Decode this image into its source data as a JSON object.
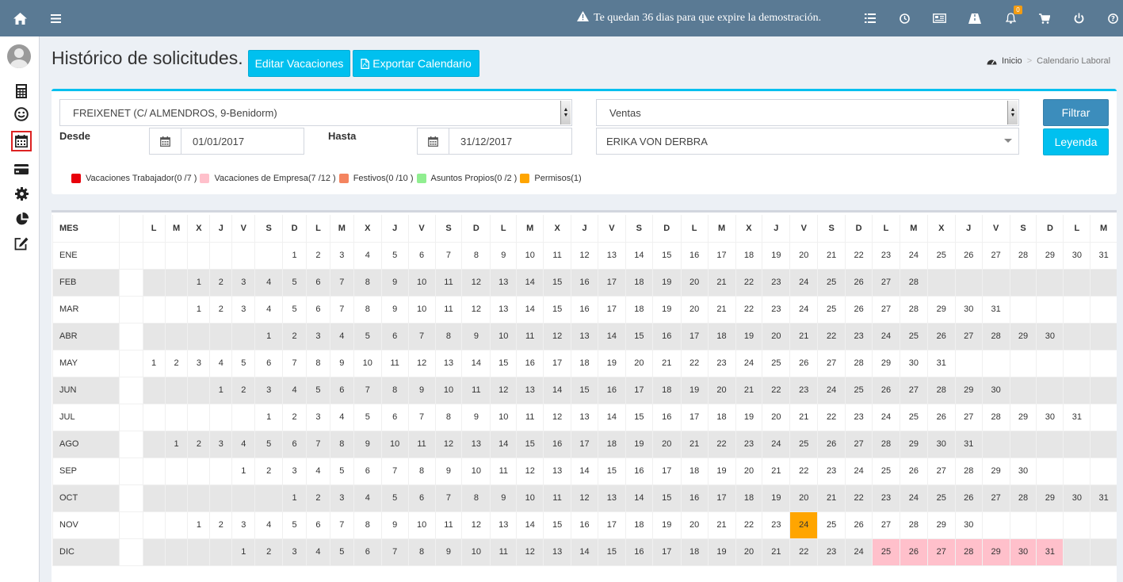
{
  "topbar": {
    "demo_message": "Te quedan 36 dias para que expire la demostración.",
    "notifications_count": "0",
    "icons": [
      "home-icon",
      "menu-icon",
      "warning-icon",
      "list-icon",
      "clock-icon",
      "newspaper-icon",
      "road-icon",
      "bell-icon",
      "cart-icon",
      "power-icon",
      "help-icon"
    ]
  },
  "sidebar": {
    "items": [
      "calculator-icon",
      "smile-icon",
      "calendar-icon",
      "credit-card-icon",
      "gear-icon",
      "pie-chart-icon",
      "edit-icon"
    ],
    "active": "calendar-icon"
  },
  "header": {
    "title": "Histórico de solicitudes.",
    "edit_button": "Editar Vacaciones",
    "export_button": "Exportar Calendario",
    "breadcrumb_home": "Inicio",
    "breadcrumb_current": "Calendario Laboral"
  },
  "filters": {
    "center": "FREIXENET (C/ ALMENDROS, 9-Benidorm)",
    "department": "Ventas",
    "employee": "ERIKA VON DERBRA",
    "from_label": "Desde",
    "from_value": "01/01/2017",
    "to_label": "Hasta",
    "to_value": "31/12/2017",
    "filter_button": "Filtrar",
    "legend_button": "Leyenda"
  },
  "legend": [
    {
      "label": "Vacaciones Trabajador(0 /7 )",
      "color": "#e8000b"
    },
    {
      "label": "Vacaciones de Empresa(7 /12 )",
      "color": "#ffc0cb"
    },
    {
      "label": "Festivos(0 /10 )",
      "color": "#f4845f"
    },
    {
      "label": "Asuntos Propios(0 /2 )",
      "color": "#90ee90"
    },
    {
      "label": "Permisos(1)",
      "color": "#ffa500"
    }
  ],
  "calendar": {
    "month_header": "MES",
    "day_headers": [
      "L",
      "M",
      "X",
      "J",
      "V",
      "S",
      "D",
      "L",
      "M",
      "X",
      "J",
      "V",
      "S",
      "D",
      "L",
      "M",
      "X",
      "J",
      "V",
      "S",
      "D",
      "L",
      "M",
      "X",
      "J",
      "V",
      "S",
      "D",
      "L",
      "M",
      "X",
      "J",
      "V",
      "S",
      "D",
      "L",
      "M"
    ],
    "months": [
      {
        "name": "ENE",
        "offset": 6,
        "days": 31
      },
      {
        "name": "FEB",
        "offset": 2,
        "days": 28
      },
      {
        "name": "MAR",
        "offset": 2,
        "days": 31
      },
      {
        "name": "ABR",
        "offset": 5,
        "days": 30
      },
      {
        "name": "MAY",
        "offset": 0,
        "days": 31
      },
      {
        "name": "JUN",
        "offset": 3,
        "days": 30
      },
      {
        "name": "JUL",
        "offset": 5,
        "days": 31
      },
      {
        "name": "AGO",
        "offset": 1,
        "days": 31
      },
      {
        "name": "SEP",
        "offset": 4,
        "days": 30
      },
      {
        "name": "OCT",
        "offset": 6,
        "days": 31
      },
      {
        "name": "NOV",
        "offset": 2,
        "days": 30
      },
      {
        "name": "DIC",
        "offset": 4,
        "days": 31
      }
    ],
    "highlights": [
      {
        "month": "NOV",
        "day": 24,
        "type": "Permisos",
        "color": "#ffa500"
      },
      {
        "month": "DIC",
        "day": 25,
        "type": "Vacaciones de Empresa",
        "color": "#ffc0cb"
      },
      {
        "month": "DIC",
        "day": 26,
        "type": "Vacaciones de Empresa",
        "color": "#ffc0cb"
      },
      {
        "month": "DIC",
        "day": 27,
        "type": "Vacaciones de Empresa",
        "color": "#ffc0cb"
      },
      {
        "month": "DIC",
        "day": 28,
        "type": "Vacaciones de Empresa",
        "color": "#ffc0cb"
      },
      {
        "month": "DIC",
        "day": 29,
        "type": "Vacaciones de Empresa",
        "color": "#ffc0cb"
      },
      {
        "month": "DIC",
        "day": 30,
        "type": "Vacaciones de Empresa",
        "color": "#ffc0cb"
      },
      {
        "month": "DIC",
        "day": 31,
        "type": "Vacaciones de Empresa",
        "color": "#ffc0cb"
      }
    ]
  }
}
